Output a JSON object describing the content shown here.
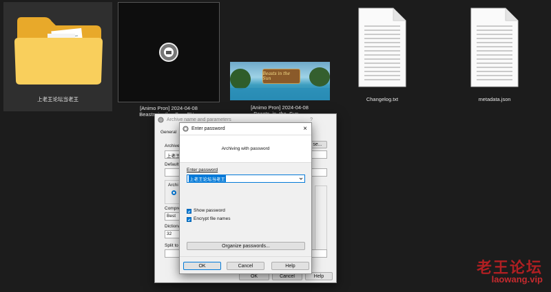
{
  "desktop": {
    "files": [
      {
        "name": "上老王论坛当老王",
        "type": "folder"
      },
      {
        "name": "[Animo Pron] 2024-04-08\nBeasts_in_the_Sun_FN...",
        "type": "video"
      },
      {
        "name": "[Animo Pron] 2024-04-08\nBeasts_in_the_Sun_...",
        "type": "image"
      },
      {
        "name": "Changelog.txt",
        "type": "text"
      },
      {
        "name": "metadata.json",
        "type": "text"
      }
    ],
    "thumb_text": "Beasts in the Sun"
  },
  "archive_dialog": {
    "title": "Archive name and parameters",
    "help_glyph": "?",
    "tab_general": "General",
    "archive_label": "Archive",
    "archive_value": "上老王",
    "browse_label": "se...",
    "default_label": "Default",
    "archive_format_label": "Archi",
    "compression_label": "Compre",
    "compression_value": "Best",
    "dictionary_label": "Dictiona",
    "dictionary_value": "32",
    "split_label": "Split to",
    "ok": "OK",
    "cancel": "Cancel",
    "help": "Help"
  },
  "password_dialog": {
    "title": "Enter password",
    "close_glyph": "×",
    "subtitle": "Archiving with password",
    "enter_label": "Enter password",
    "password_value": "上老王论坛当老王",
    "show_password": "Show password",
    "encrypt_names": "Encrypt file names",
    "organize": "Organize passwords...",
    "ok": "OK",
    "cancel": "Cancel",
    "help": "Help"
  },
  "watermark": {
    "line1": "老王论坛",
    "line2": "laowang.vip"
  },
  "colors": {
    "accent": "#0078d7",
    "watermark": "#b01f22",
    "folder": "#f7c948"
  }
}
